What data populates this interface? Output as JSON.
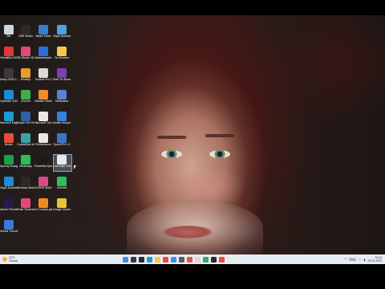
{
  "desktop": {
    "icons": [
      {
        "label": "Bin",
        "icon": "recycle-bin-icon",
        "color": "#cfd6de"
      },
      {
        "label": "OBS Studio",
        "icon": "obs-icon",
        "color": "#2b2b2b"
      },
      {
        "label": "Steam Editor",
        "icon": "app-icon",
        "color": "#3a7bd5"
      },
      {
        "label": "Glyph download... (2)",
        "icon": "download-icon",
        "color": "#4aa3df"
      },
      {
        "label": "VirtualBox DST",
        "icon": "virtualbox-icon",
        "color": "#e03a3a"
      },
      {
        "label": "8K Studio HD",
        "icon": "media-icon",
        "color": "#e04a7a"
      },
      {
        "label": "Malwarebytes",
        "icon": "malwarebytes-icon",
        "color": "#2f6bd9"
      },
      {
        "label": "Tor Browser",
        "icon": "folder-icon",
        "color": "#f2c94c"
      },
      {
        "label": "Setup 2025.1.2003",
        "icon": "setup-icon",
        "color": "#3a3a3a"
      },
      {
        "label": "Winamp",
        "icon": "winamp-icon",
        "color": "#e89b2a"
      },
      {
        "label": "Toolbox Pro 3",
        "icon": "toolbox-icon",
        "color": "#d9d9d9"
      },
      {
        "label": "Start Tor Browser",
        "icon": "tor-icon",
        "color": "#7b3fb0"
      },
      {
        "label": "Cyberlink 2022.1.2003",
        "icon": "cyberlink-icon",
        "color": "#1f8ad6"
      },
      {
        "label": "uTorrent",
        "icon": "utorrent-icon",
        "color": "#3cae4a"
      },
      {
        "label": "VMware Workstation",
        "icon": "vmware-icon",
        "color": "#f28c28"
      },
      {
        "label": "Hardwares",
        "icon": "hardware-icon",
        "color": "#5a7fd8"
      },
      {
        "label": "Microsoft Edge",
        "icon": "edge-icon",
        "color": "#1c9ad8"
      },
      {
        "label": "Oracle VM VirtualBox",
        "icon": "virtualbox-icon",
        "color": "#2f5fa8"
      },
      {
        "label": "Microsoft Tool",
        "icon": "tool-icon",
        "color": "#e8e8e8"
      },
      {
        "label": "Mobile Hotspot",
        "icon": "hotspot-icon",
        "color": "#3a80d9"
      },
      {
        "label": "Buster",
        "icon": "chrome-icon",
        "color": "#e94b3c"
      },
      {
        "label": "CrystalDisk Info",
        "icon": "crystal-icon",
        "color": "#3aa3a0"
      },
      {
        "label": "Performance",
        "icon": "performance-icon",
        "color": "#e8e8e8"
      },
      {
        "label": "OpenVPN 1.0",
        "icon": "vpn-icon",
        "color": "#3b76c4"
      },
      {
        "label": "Speedy Dosage",
        "icon": "speed-icon",
        "color": "#1e9e4a"
      },
      {
        "label": "Whatsapp",
        "icon": "whatsapp-icon",
        "color": "#2dbd5a"
      },
      {
        "label": "PowerBot Speed Test",
        "icon": "speedtest-icon",
        "color": "#1a1a1a"
      },
      {
        "label": "LockTable Online",
        "icon": "lock-icon",
        "color": "#e8e8e8"
      },
      {
        "label": "Glyph Downloader",
        "icon": "glyph-icon",
        "color": "#1f8ad6"
      },
      {
        "label": "Windows Beta Activity 11",
        "icon": "terminal-icon",
        "color": "#2a2a2a"
      },
      {
        "label": "SCRNS IMAG",
        "icon": "image-icon",
        "color": "#d94a8a"
      },
      {
        "label": "uTorrent",
        "icon": "utorrent-icon",
        "color": "#2dbd5a"
      },
      {
        "label": "Adobe Premiere",
        "icon": "premiere-icon",
        "color": "#2a1a4a"
      },
      {
        "label": "Timer Reverse",
        "icon": "timer-icon",
        "color": "#e04a7a"
      },
      {
        "label": "VLC media player",
        "icon": "vlc-icon",
        "color": "#f08a24"
      },
      {
        "label": "Google Chrome",
        "icon": "chrome-icon",
        "color": "#e9c23c"
      },
      {
        "label": "Unlock Thunderbird",
        "icon": "app-icon",
        "color": "#3a7bd5"
      }
    ]
  },
  "taskbar": {
    "weather_temp": "23°C",
    "weather_desc": "Cloudy",
    "buttons": [
      {
        "icon": "windows-start-icon",
        "color": "#3a8ee6"
      },
      {
        "icon": "search-icon",
        "color": "#3a3a3a"
      },
      {
        "icon": "task-view-icon",
        "color": "#2a2a2a"
      },
      {
        "icon": "edge-icon",
        "color": "#1c9ad8"
      },
      {
        "icon": "file-explorer-icon",
        "color": "#f2c94c"
      },
      {
        "icon": "chrome-icon",
        "color": "#e94b3c"
      },
      {
        "icon": "store-icon",
        "color": "#3a8ee6"
      },
      {
        "icon": "settings-icon",
        "color": "#5a5a5a"
      },
      {
        "icon": "app-icon",
        "color": "#e05a3a"
      },
      {
        "icon": "app-icon",
        "color": "#d9d9d9"
      },
      {
        "icon": "app-icon",
        "color": "#3aa36a"
      },
      {
        "icon": "app-icon",
        "color": "#2a2a2a"
      },
      {
        "icon": "app-icon",
        "color": "#e94b3c"
      }
    ],
    "tray": {
      "chevron": "^",
      "lang": "ENG",
      "time": "10:24",
      "date": "02-01-2023"
    }
  }
}
